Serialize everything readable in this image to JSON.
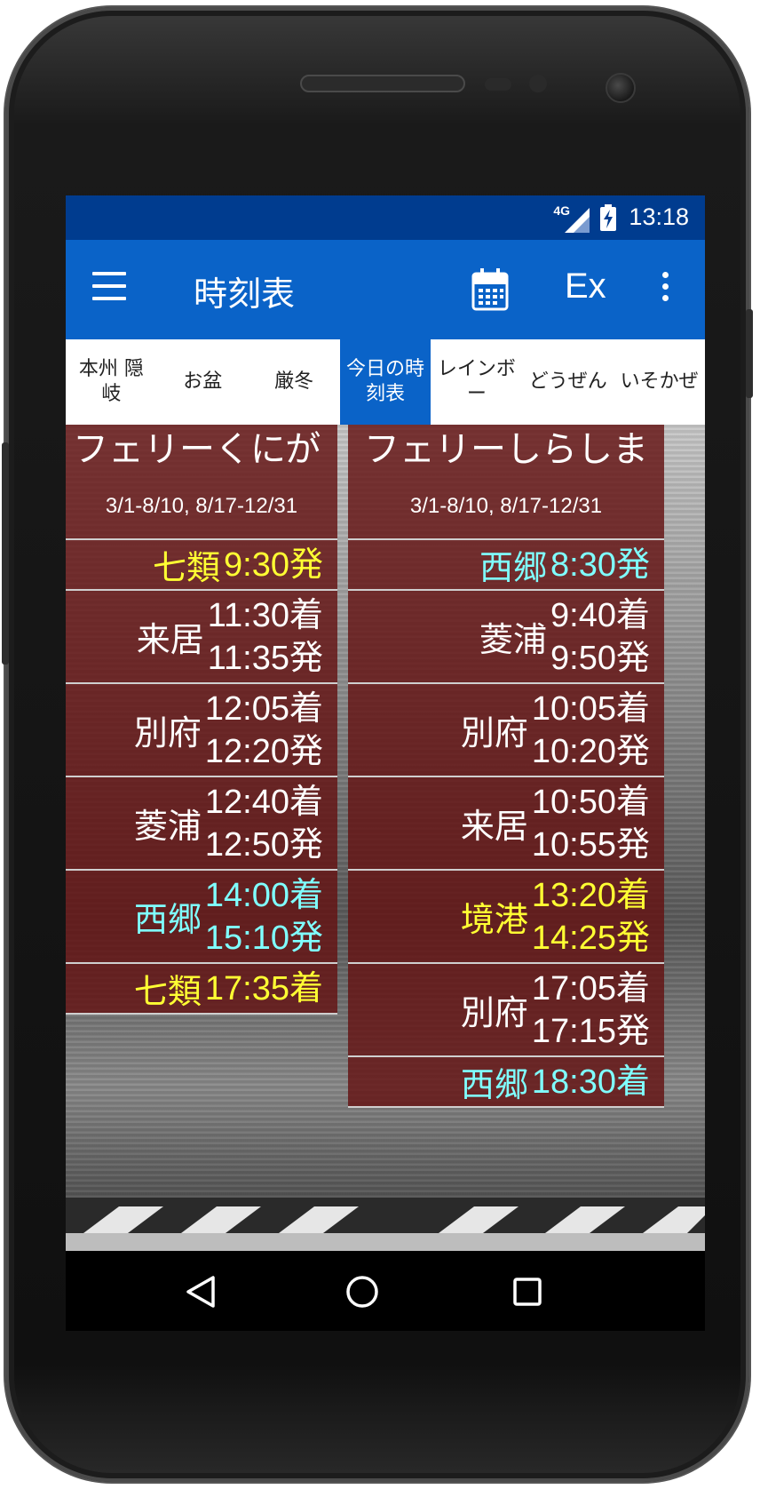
{
  "status_bar": {
    "network": "4G",
    "time": "13:18"
  },
  "app_bar": {
    "title": "時刻表",
    "ex_label": "Ex"
  },
  "tabs": [
    {
      "label": "本州 隠岐"
    },
    {
      "label": "お盆"
    },
    {
      "label": "厳冬"
    },
    {
      "label": "今日の時刻表",
      "active": true
    },
    {
      "label": "レインボー"
    },
    {
      "label": "どうぜん"
    },
    {
      "label": "いそかぜ"
    }
  ],
  "colors": {
    "status_bar": "#003c8f",
    "app_bar": "#0a63c8",
    "active_tab": "#0a63c8",
    "card_bg": "#641212",
    "white_text": "#ffffff",
    "yellow_text": "#ffff33",
    "cyan_text": "#7fffff"
  },
  "ferries": [
    {
      "name": "フェリーくにが",
      "period": "3/1-8/10, 8/17-12/31",
      "stops": [
        {
          "port": "七類",
          "times": [
            "9:30発"
          ],
          "color": "#ffff33"
        },
        {
          "port": "来居",
          "times": [
            "11:30着",
            "11:35発"
          ],
          "color": "#ffffff"
        },
        {
          "port": "別府",
          "times": [
            "12:05着",
            "12:20発"
          ],
          "color": "#ffffff"
        },
        {
          "port": "菱浦",
          "times": [
            "12:40着",
            "12:50発"
          ],
          "color": "#ffffff"
        },
        {
          "port": "西郷",
          "times": [
            "14:00着",
            "15:10発"
          ],
          "color": "#7fffff"
        },
        {
          "port": "七類",
          "times": [
            "17:35着"
          ],
          "color": "#ffff33"
        }
      ]
    },
    {
      "name": "フェリーしらしま",
      "period": "3/1-8/10, 8/17-12/31",
      "stops": [
        {
          "port": "西郷",
          "times": [
            "8:30発"
          ],
          "color": "#7fffff"
        },
        {
          "port": "菱浦",
          "times": [
            "9:40着",
            "9:50発"
          ],
          "color": "#ffffff"
        },
        {
          "port": "別府",
          "times": [
            "10:05着",
            "10:20発"
          ],
          "color": "#ffffff"
        },
        {
          "port": "来居",
          "times": [
            "10:50着",
            "10:55発"
          ],
          "color": "#ffffff"
        },
        {
          "port": "境港",
          "times": [
            "13:20着",
            "14:25発"
          ],
          "color": "#ffff33"
        },
        {
          "port": "別府",
          "times": [
            "17:05着",
            "17:15発"
          ],
          "color": "#ffffff"
        },
        {
          "port": "西郷",
          "times": [
            "18:30着"
          ],
          "color": "#7fffff"
        }
      ]
    }
  ],
  "nav_icons": [
    "back-icon",
    "home-icon",
    "recents-icon"
  ]
}
